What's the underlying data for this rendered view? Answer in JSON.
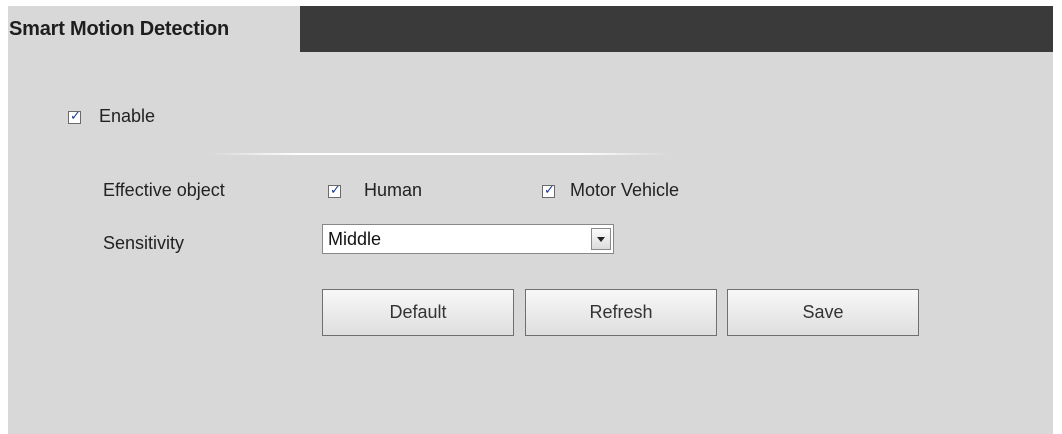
{
  "header": {
    "title": "Smart Motion Detection"
  },
  "enable": {
    "label": "Enable",
    "checked": true
  },
  "effective_object": {
    "label": "Effective object",
    "options": [
      {
        "label": "Human",
        "checked": true
      },
      {
        "label": "Motor Vehicle",
        "checked": true
      }
    ]
  },
  "sensitivity": {
    "label": "Sensitivity",
    "value": "Middle"
  },
  "buttons": {
    "default_label": "Default",
    "refresh_label": "Refresh",
    "save_label": "Save"
  },
  "colors": {
    "header_dark": "#3a3a3a",
    "panel_bg": "#d8d8d8",
    "checkmark": "#1e3c8c"
  },
  "icons": {
    "dropdown": "chevron-down-icon",
    "checkbox": "checkbox-icon"
  }
}
